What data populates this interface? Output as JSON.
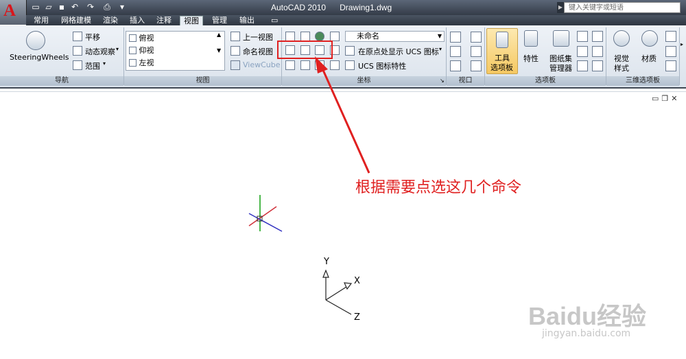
{
  "title_bar": {
    "app_letter": "A",
    "app_title": "AutoCAD 2010",
    "doc_title": "Drawing1.dwg",
    "search_placeholder": "键入关键字或短语"
  },
  "tabs": [
    "常用",
    "网格建模",
    "渲染",
    "插入",
    "注释",
    "视图",
    "管理",
    "输出"
  ],
  "active_tab": "视图",
  "ribbon": {
    "navigation": {
      "title": "导航",
      "steering_wheels": "SteeringWheels",
      "pan": "平移",
      "orbit": "动态观察",
      "extents": "范围"
    },
    "views": {
      "title": "视图",
      "list": [
        "俯视",
        "仰视",
        "左视"
      ],
      "prev_view": "上一视图",
      "named_views": "命名视图",
      "viewcube": "ViewCube"
    },
    "coordinates": {
      "title": "坐标",
      "ucs_name": "未命名",
      "show_ucs_at_origin": "在原点处显示 UCS 图标",
      "ucs_icon_props": "UCS 图标特性"
    },
    "viewports": {
      "title": "视口"
    },
    "palettes": {
      "title": "选项板",
      "tool_palette_line1": "工具",
      "tool_palette_line2": "选项板",
      "properties": "特性",
      "sheet_set_line1": "图纸集",
      "sheet_set_line2": "管理器"
    },
    "palettes3d": {
      "title": "三维选项板",
      "visual_styles_line1": "视觉",
      "visual_styles_line2": "样式",
      "materials": "材质"
    }
  },
  "canvas": {
    "annotation": "根据需要点选这几个命令",
    "ucs_labels": {
      "x": "X",
      "y": "Y",
      "z": "Z"
    },
    "watermark": "Baidu经验",
    "watermark_url": "jingyan.baidu.com"
  },
  "colors": {
    "highlight": "#e02020",
    "axis_x": "#d0303a",
    "axis_y": "#10a010",
    "axis_z": "#3030c0"
  }
}
